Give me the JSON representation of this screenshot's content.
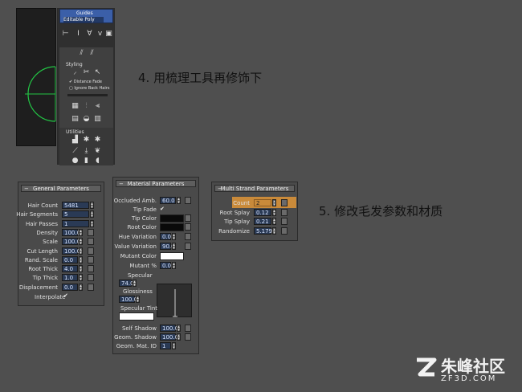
{
  "steps": {
    "step4": "4. 用梳理工具再修饰下",
    "step5": "5. 修改毛发参数和材质"
  },
  "viewport_panel": {
    "stack_items": [
      "Guides",
      "Editable Poly"
    ],
    "styling_label": "Styling",
    "distance_fade": "Distance Fade",
    "ignore_back_hairs": "Ignore Back Hairs",
    "utilities_label": "Utilities"
  },
  "general_params": {
    "title": "General Parameters",
    "rows": [
      {
        "label": "Hair Count",
        "value": "5481"
      },
      {
        "label": "Hair Segments",
        "value": "5"
      },
      {
        "label": "Hair Passes",
        "value": "1"
      },
      {
        "label": "Density",
        "value": "100.0"
      },
      {
        "label": "Scale",
        "value": "100.0"
      },
      {
        "label": "Cut Length",
        "value": "100.0"
      },
      {
        "label": "Rand. Scale",
        "value": "0.0"
      },
      {
        "label": "Root Thick",
        "value": "4.0"
      },
      {
        "label": "Tip Thick",
        "value": "1.0"
      },
      {
        "label": "Displacement",
        "value": "0.0"
      }
    ],
    "interpolate": "Interpolate"
  },
  "material_params": {
    "title": "Material Parameters",
    "occluded": {
      "label": "Occluded Amb.",
      "value": "60.0"
    },
    "tip_fade": "Tip Fade",
    "tip_color": "Tip Color",
    "root_color": "Root Color",
    "hue_variation": {
      "label": "Hue Variation",
      "value": "0.0"
    },
    "value_variation": {
      "label": "Value Variation",
      "value": "90.0"
    },
    "mutant_color": "Mutant Color",
    "mutant_pct": {
      "label": "Mutant %",
      "value": "0.0"
    },
    "specular": {
      "label": "Specular",
      "value": "74.0"
    },
    "glossiness": {
      "label": "Glossiness",
      "value": "100.0"
    },
    "specular_tint": "Specular Tint",
    "self_shadow": {
      "label": "Self Shadow",
      "value": "100.0"
    },
    "geom_shadow": {
      "label": "Geom. Shadow",
      "value": "100.0"
    },
    "geom_mat_id": {
      "label": "Geom. Mat. ID",
      "value": "1"
    }
  },
  "multistrand_params": {
    "title": "Multi Strand Parameters",
    "rows": [
      {
        "label": "Count",
        "value": "2"
      },
      {
        "label": "Root Splay",
        "value": "0.12"
      },
      {
        "label": "Tip Splay",
        "value": "0.21"
      },
      {
        "label": "Randomize",
        "value": "5.179"
      }
    ]
  },
  "watermark": {
    "brand": "朱峰社区",
    "domain": "ZF3D.COM"
  },
  "colors": {
    "highlight": "#c98a3a",
    "field": "#2a3a55",
    "gizmo": "#22c444"
  }
}
